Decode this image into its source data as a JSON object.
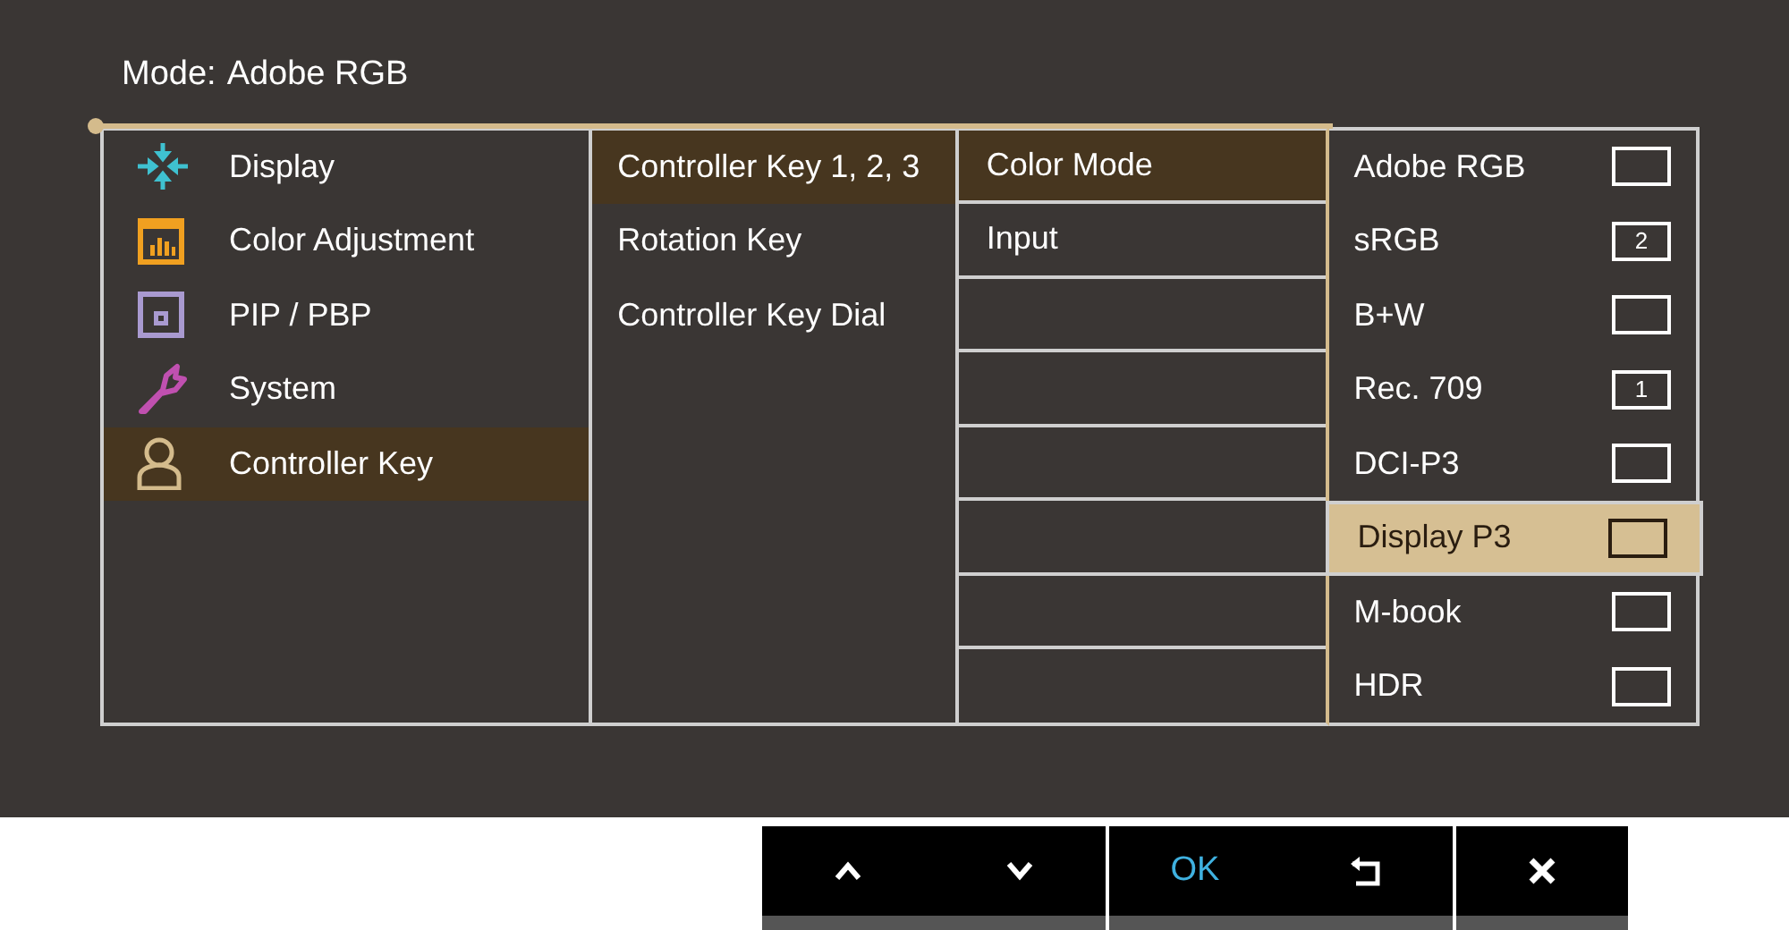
{
  "header": {
    "mode_label": "Mode:",
    "mode_value": "Adobe RGB"
  },
  "main_menu": [
    {
      "label": "Display",
      "selected": false
    },
    {
      "label": "Color Adjustment",
      "selected": false
    },
    {
      "label": "PIP / PBP",
      "selected": false
    },
    {
      "label": "System",
      "selected": false
    },
    {
      "label": "Controller Key",
      "selected": true
    }
  ],
  "submenu": [
    {
      "label": "Controller Key 1, 2, 3",
      "selected": true
    },
    {
      "label": "Rotation Key",
      "selected": false
    },
    {
      "label": "Controller Key Dial",
      "selected": false
    }
  ],
  "function_menu": [
    {
      "label": "Color Mode",
      "selected": true
    },
    {
      "label": "Input",
      "selected": false
    }
  ],
  "options": [
    {
      "label": "Adobe RGB",
      "selected": false
    },
    {
      "label": "sRGB",
      "selected": false,
      "slot": "2"
    },
    {
      "label": "B+W",
      "selected": false
    },
    {
      "label": "Rec. 709",
      "selected": false,
      "slot": "1"
    },
    {
      "label": "DCI-P3",
      "selected": false
    },
    {
      "label": "Display P3",
      "selected": true
    },
    {
      "label": "M-book",
      "selected": false
    },
    {
      "label": "HDR",
      "selected": false
    }
  ],
  "key_groups": [
    {
      "keys": [
        {
          "kind": "up"
        },
        {
          "kind": "down"
        }
      ]
    },
    {
      "keys": [
        {
          "kind": "text",
          "label": "OK"
        },
        {
          "kind": "back"
        }
      ]
    },
    {
      "keys": [
        {
          "kind": "close"
        }
      ]
    }
  ]
}
